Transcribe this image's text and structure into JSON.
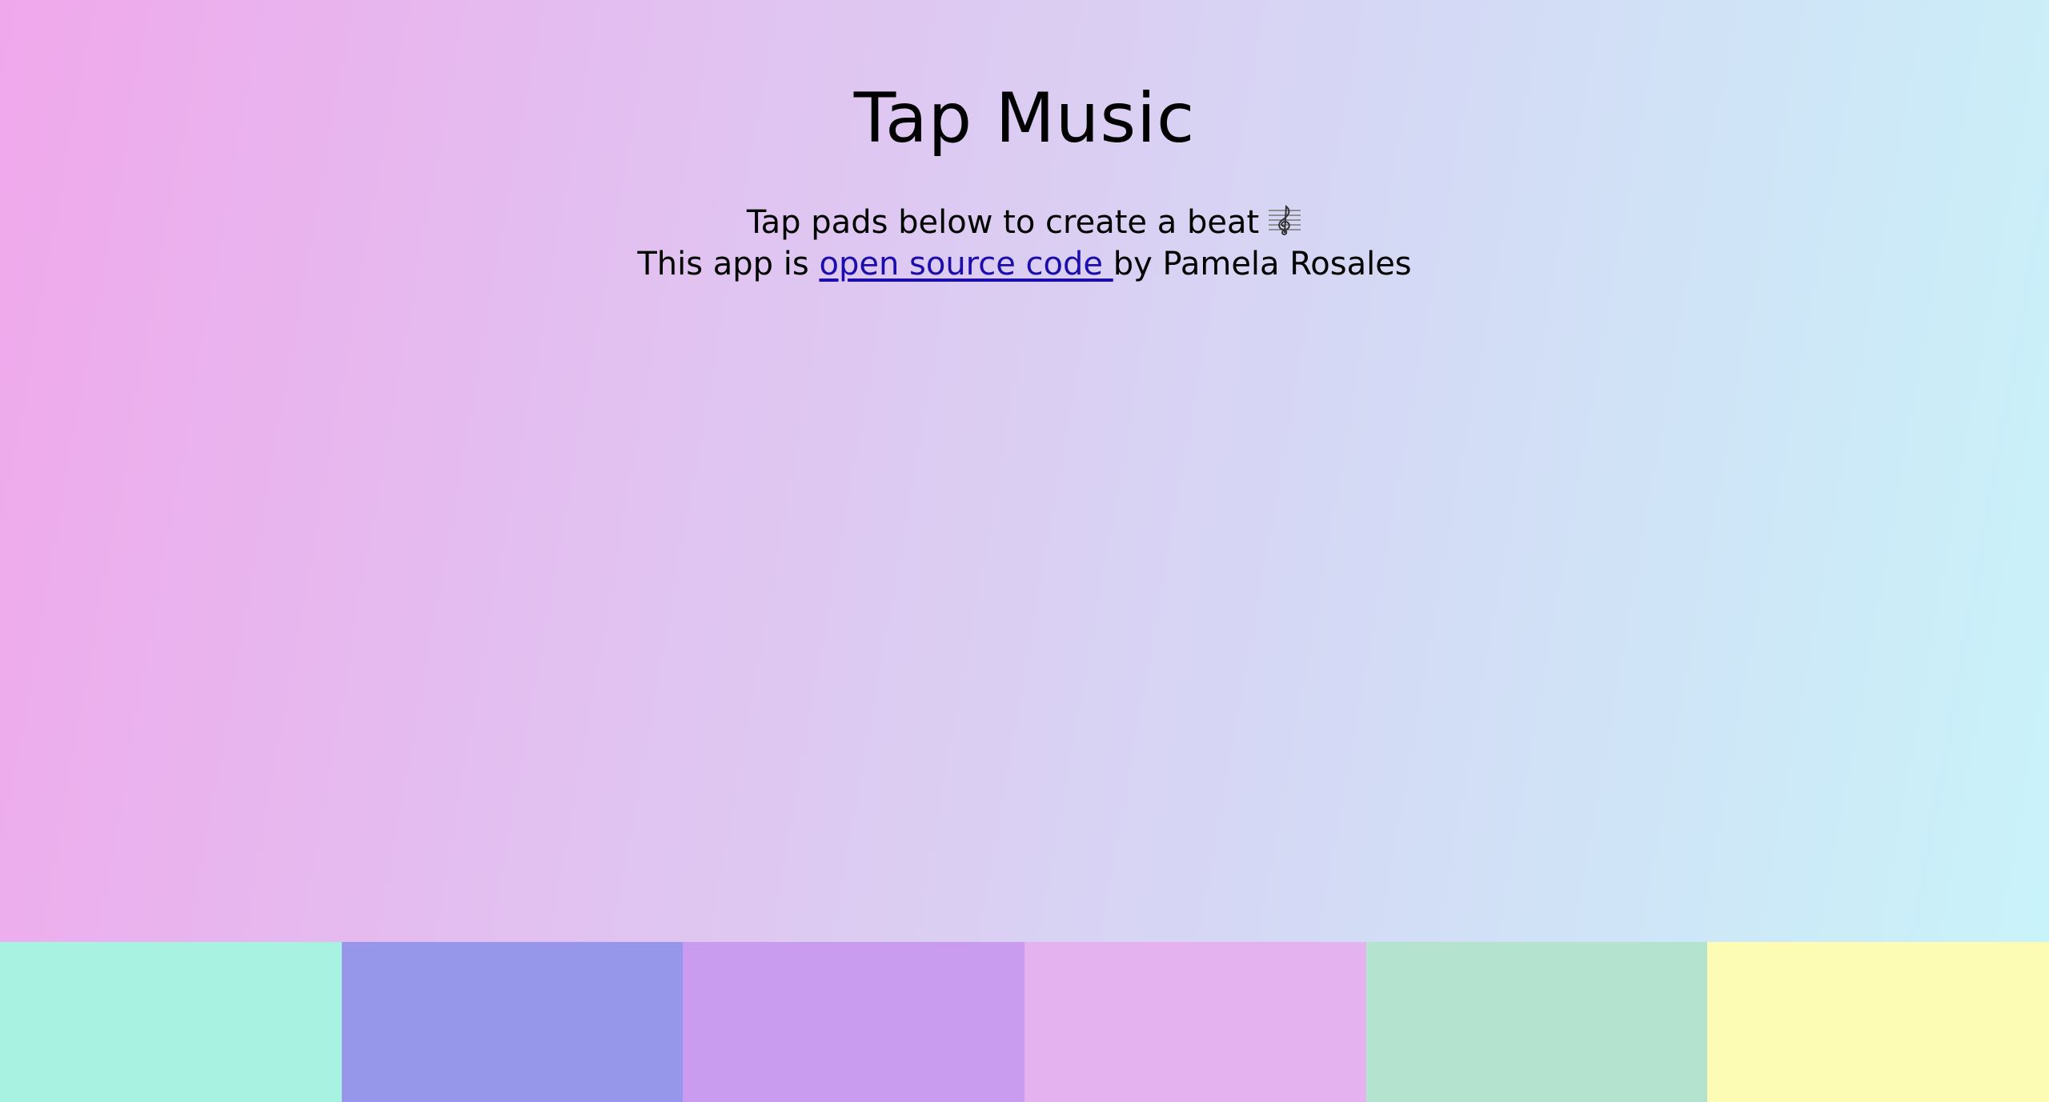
{
  "header": {
    "title": "Tap Music",
    "line1": "Tap pads below to create a beat",
    "line1_icon": "treble-clef-icon",
    "line2_prefix": "This app is ",
    "line2_link": "open source code ",
    "line2_suffix": "by Pamela Rosales"
  },
  "colors": {
    "link": "#1a0dab",
    "gradient_start": "#f0a8ec",
    "gradient_end": "#c8f4fa"
  },
  "pads": [
    {
      "color": "#a8f2e2"
    },
    {
      "color": "#9696ea"
    },
    {
      "color": "#c99cf0"
    },
    {
      "color": "#e4b2ee"
    },
    {
      "color": "#b4e4d0"
    },
    {
      "color": "#fcfcb4"
    }
  ]
}
